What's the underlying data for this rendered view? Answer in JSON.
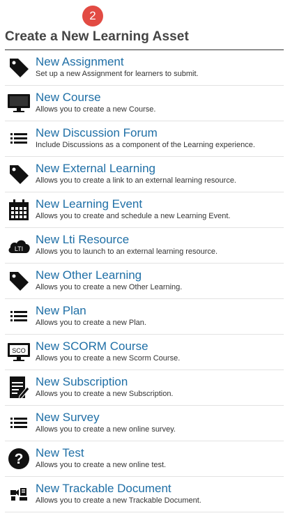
{
  "step_badge": "2",
  "page_title": "Create a New Learning Asset",
  "items": [
    {
      "title": "New Assignment",
      "desc": "Set up a new Assignment for learners to submit.",
      "icon": "tag-icon"
    },
    {
      "title": "New Course",
      "desc": "Allows you to create a new Course.",
      "icon": "monitor-icon"
    },
    {
      "title": "New Discussion Forum",
      "desc": "Include Discussions as a component of the Learning experience.",
      "icon": "list-icon"
    },
    {
      "title": "New External Learning",
      "desc": "Allows you to create a link to an external learning resource.",
      "icon": "tag-icon"
    },
    {
      "title": "New Learning Event",
      "desc": "Allows you to create and schedule a new Learning Event.",
      "icon": "calendar-icon"
    },
    {
      "title": "New Lti Resource",
      "desc": "Allows you to launch to an external learning resource.",
      "icon": "lti-cloud-icon",
      "icon_text": "LTI"
    },
    {
      "title": "New Other Learning",
      "desc": "Allows you to create a new Other Learning.",
      "icon": "tag-icon"
    },
    {
      "title": "New Plan",
      "desc": "Allows you to create a new Plan.",
      "icon": "list-icon"
    },
    {
      "title": "New SCORM Course",
      "desc": "Allows you to create a new Scorm Course.",
      "icon": "scorm-monitor-icon",
      "icon_text": "SCO"
    },
    {
      "title": "New Subscription",
      "desc": "Allows you to create a new Subscription.",
      "icon": "subscription-icon"
    },
    {
      "title": "New Survey",
      "desc": "Allows you to create a new online survey.",
      "icon": "list-icon"
    },
    {
      "title": "New Test",
      "desc": "Allows you to create a new online test.",
      "icon": "question-icon"
    },
    {
      "title": "New Trackable Document",
      "desc": "Allows you to create a new Trackable Document.",
      "icon": "trackable-document-icon"
    }
  ],
  "colors": {
    "badge": "#e24b43",
    "link": "#1f6fa6",
    "title": "#444444"
  }
}
